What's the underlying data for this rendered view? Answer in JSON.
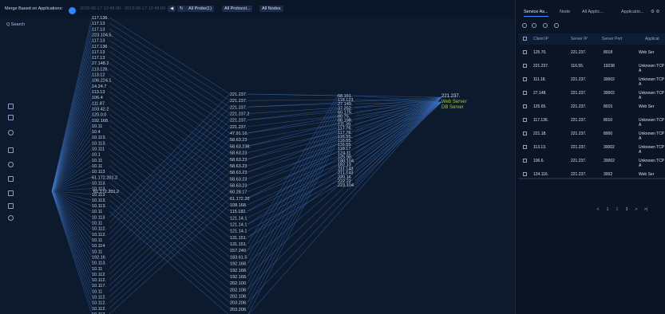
{
  "topbar": {
    "merge_label": "Merge Based on Applications:",
    "date_range": "2020-05-17 12:48:00 - 2019-06-17 12:48:00",
    "prev_icon": "chevron-left-icon",
    "refresh_icon": "refresh-icon",
    "filter1": "All Probe(1)",
    "filter2": "All Protocol...",
    "filter3": "All Nodes"
  },
  "sidebar": {
    "search_label": "Q Search"
  },
  "graph": {
    "col1": [
      "117.136.",
      "117.13",
      "117.13",
      "223.104.5.",
      "117.13",
      "117.136",
      "117.13",
      "117.13",
      "27.148.2",
      "113.126.",
      "113.12",
      "106.224.1",
      "14.24.7",
      "113.13",
      "106.4",
      "111.87.",
      "103.42.2",
      "120.0.0",
      "192.168.",
      "10.11",
      "10.4",
      "10.113.",
      "10.113.",
      "10.111",
      "10.1",
      "10.11",
      "10.11",
      "10.113",
      "61.172.201.2",
      "10.113.",
      "10.113.",
      "10.113",
      "10.113.",
      "10.113.",
      "10.11",
      "10.113",
      "10.11",
      "10.112.",
      "10.112.",
      "10.11",
      "10.114",
      "10.11",
      "192.16",
      "10.113.",
      "10.11",
      "10.112",
      "10.112.",
      "10.117.",
      "10.11",
      "10.112.",
      "10.112.",
      "10.112.",
      "10.112."
    ],
    "col1_ys": [
      22,
      32,
      39,
      46,
      53,
      61,
      68,
      76,
      83,
      91,
      98,
      106,
      113,
      121,
      128,
      136,
      143,
      151,
      158,
      166,
      173,
      181,
      188,
      196,
      203,
      211,
      218,
      226,
      233,
      241,
      248,
      256,
      263,
      271,
      278,
      286,
      293,
      301,
      308,
      316,
      323,
      331,
      338,
      346,
      353,
      361,
      368,
      376,
      383,
      390
    ],
    "left_node": "61.172.201.2",
    "col2": [
      "221.237.",
      "221.237.",
      "221.237.",
      "221.237.2",
      "221.237.",
      "221.237.",
      "47.91.16.",
      "58.63.23",
      "58.63.236.",
      "58.63.23",
      "58.63.23",
      "58.63.23",
      "58.63.23",
      "58.63.23",
      "58.63.23",
      "60.28.17",
      "61.172.20",
      "108.168.",
      "115.182.",
      "121.14.1",
      "121.14.1",
      "121.14.1",
      "131.151.",
      "131.151.",
      "157.240.",
      "183.61.5",
      "192.168.",
      "192.168.",
      "192.168.",
      "202.100.",
      "202.108.",
      "202.108.",
      "203.208.",
      "203.208.",
      "203.208."
    ],
    "col3": [
      "68.161.",
      "118.123.",
      "27.149.",
      "37.252.",
      "60.175.",
      "80.75.",
      "88.198.",
      "111.39.",
      "117.76.",
      "117.76.",
      "116.55.",
      "116.55.",
      "116.55.",
      "118.17",
      "124.11",
      "125.90.",
      "180.104.",
      "182.13",
      "211.143",
      "211.143",
      "220.16",
      "222.22",
      "223.104."
    ],
    "right_labels": [
      "221.237.",
      "Web Server",
      "DB Server"
    ]
  },
  "panel": {
    "tabs": [
      "Service As...",
      "Node",
      "All Applic...",
      "Applicatio..."
    ],
    "columns": [
      "Client IP",
      "Server IP",
      "Server Port",
      "Applicat"
    ],
    "rows": [
      [
        "125.70.",
        "221.237.",
        "8018",
        "Web Ser"
      ],
      [
        "221.237.",
        "116.55.",
        "19238",
        "Unknown TCP A"
      ],
      [
        "111.18.",
        "221.237.",
        "30002",
        "Unknown TCP A"
      ],
      [
        "27.148.",
        "221.237.",
        "30002",
        "Unknown TCP A"
      ],
      [
        "125.65.",
        "221.237.",
        "8015",
        "Web Ser"
      ],
      [
        "117.136.",
        "221.237.",
        "8010",
        "Unknown TCP A"
      ],
      [
        "221.18.",
        "221.237.",
        "8000",
        "Unknown TCP A"
      ],
      [
        "113.13.",
        "221.237.",
        "30002",
        "Unknown TCP A"
      ],
      [
        "106.6.",
        "221.237.",
        "30002",
        "Unknown TCP A"
      ],
      [
        "124.116.",
        "221.237.",
        "3002",
        "Web Ser"
      ]
    ],
    "pager": [
      "<",
      "1",
      "2",
      "3",
      ">",
      ">|"
    ]
  },
  "colors": {
    "accent": "#2f86ff",
    "bg": "#0d1a2e",
    "link": "#3f78c9",
    "green": "#9bd22a"
  }
}
